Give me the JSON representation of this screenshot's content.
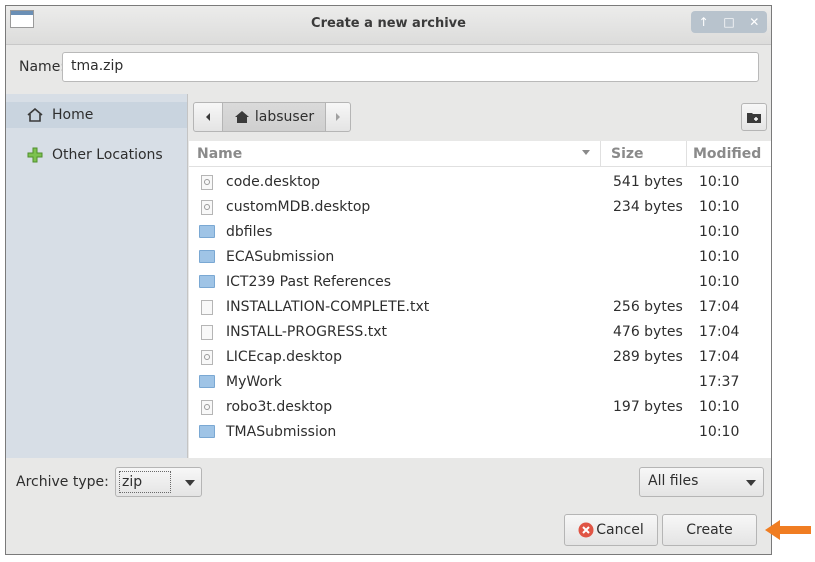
{
  "window": {
    "title": "Create a new archive",
    "wm_buttons": [
      "↑",
      "□",
      "✕"
    ]
  },
  "name_field": {
    "label": "Name:",
    "value": "tma.zip"
  },
  "sidebar": {
    "items": [
      {
        "label": "Home",
        "icon": "home-icon"
      },
      {
        "label": "Other Locations",
        "icon": "plus-icon"
      }
    ]
  },
  "pathbar": {
    "back_icon": "chevron-left-icon",
    "current": "labsuser",
    "forward_icon": "chevron-right-icon"
  },
  "columns": {
    "name": "Name",
    "size": "Size",
    "modified": "Modified"
  },
  "files": [
    {
      "name": "code.desktop",
      "size": "541 bytes",
      "modified": "10:10",
      "type": "desktop"
    },
    {
      "name": "customMDB.desktop",
      "size": "234 bytes",
      "modified": "10:10",
      "type": "desktop"
    },
    {
      "name": "dbfiles",
      "size": "",
      "modified": "10:10",
      "type": "folder"
    },
    {
      "name": "ECASubmission",
      "size": "",
      "modified": "10:10",
      "type": "folder"
    },
    {
      "name": "ICT239 Past References",
      "size": "",
      "modified": "10:10",
      "type": "folder"
    },
    {
      "name": "INSTALLATION-COMPLETE.txt",
      "size": "256 bytes",
      "modified": "17:04",
      "type": "text"
    },
    {
      "name": "INSTALL-PROGRESS.txt",
      "size": "476 bytes",
      "modified": "17:04",
      "type": "text"
    },
    {
      "name": "LICEcap.desktop",
      "size": "289 bytes",
      "modified": "17:04",
      "type": "desktop"
    },
    {
      "name": "MyWork",
      "size": "",
      "modified": "17:37",
      "type": "folder"
    },
    {
      "name": "robo3t.desktop",
      "size": "197 bytes",
      "modified": "10:10",
      "type": "desktop"
    },
    {
      "name": "TMASubmission",
      "size": "",
      "modified": "10:10",
      "type": "folder"
    }
  ],
  "archive_type": {
    "label": "Archive type:",
    "value": "zip"
  },
  "filter": {
    "value": "All files"
  },
  "buttons": {
    "cancel": "Cancel",
    "create": "Create"
  },
  "colors": {
    "sidebar_bg": "#d7dee6",
    "folder": "#9fc4e6",
    "annotation_arrow": "#f07d22",
    "cancel_icon": "#e05545"
  }
}
